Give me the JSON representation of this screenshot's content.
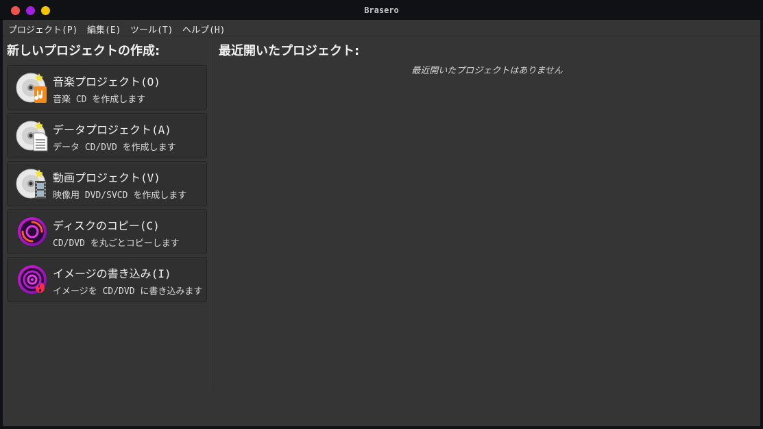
{
  "window": {
    "title": "Brasero",
    "controls": [
      "close",
      "minimize",
      "maximize"
    ],
    "accent_colors": {
      "close": "#f0524d",
      "minimize": "#a21fe0",
      "maximize": "#f5c400"
    }
  },
  "menubar": {
    "items": [
      {
        "label": "プロジェクト(P)"
      },
      {
        "label": "編集(E)"
      },
      {
        "label": "ツール(T)"
      },
      {
        "label": "ヘルプ(H)"
      }
    ]
  },
  "left": {
    "heading": "新しいプロジェクトの作成:",
    "projects": [
      {
        "label": "音楽プロジェクト(O)",
        "desc": "音楽 CD を作成します",
        "icon": "audio-disc-icon"
      },
      {
        "label": "データプロジェクト(A)",
        "desc": "データ CD/DVD を作成します",
        "icon": "data-disc-icon"
      },
      {
        "label": "動画プロジェクト(V)",
        "desc": "映像用 DVD/SVCD を作成します",
        "icon": "video-disc-icon"
      },
      {
        "label": "ディスクのコピー(C)",
        "desc": "CD/DVD を丸ごとコピーします",
        "icon": "disc-copy-icon"
      },
      {
        "label": "イメージの書き込み(I)",
        "desc": "イメージを CD/DVD に書き込みます",
        "icon": "image-burn-icon"
      }
    ]
  },
  "right": {
    "heading": "最近開いたプロジェクト:",
    "empty_message": "最近開いたプロジェクトはありません"
  }
}
